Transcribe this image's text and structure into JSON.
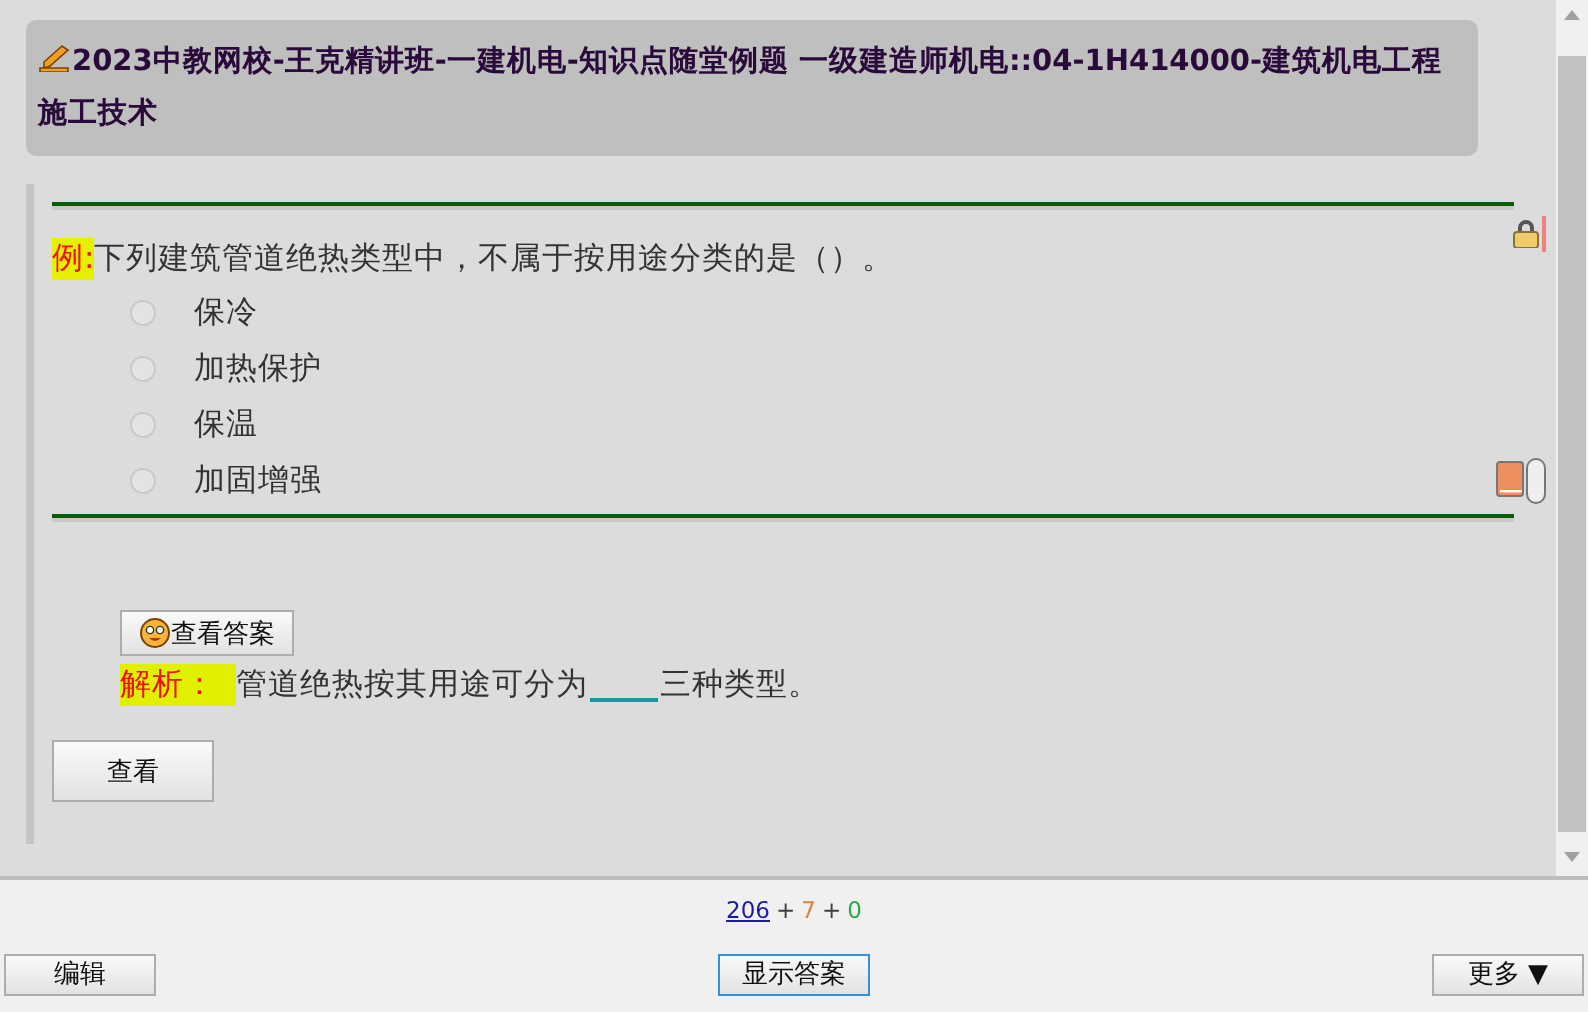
{
  "header": {
    "title": "2023中教网校-王克精讲班-一建机电-知识点随堂例题 一级建造师机电::04-1H414000-建筑机电工程施工技术"
  },
  "question": {
    "tag": "例:",
    "text": "下列建筑管道绝热类型中，不属于按用途分类的是（）。",
    "options": [
      {
        "label": "保冷",
        "selected": false
      },
      {
        "label": "加热保护",
        "selected": false
      },
      {
        "label": "保温",
        "selected": false
      },
      {
        "label": "加固增强",
        "selected": false
      }
    ]
  },
  "show_answer_button": "查看答案",
  "analysis": {
    "label": "解析：",
    "before": "管道绝热按其用途可分为",
    "after": "三种类型。"
  },
  "check_button": "查看",
  "counts": [
    {
      "text": "206",
      "color": "#1a1aa6",
      "kind": "link"
    },
    {
      "text": "+",
      "color": "#404040",
      "kind": "plain"
    },
    {
      "text": "7",
      "color": "#d9843a",
      "kind": "plain"
    },
    {
      "text": "+",
      "color": "#404040",
      "kind": "plain"
    },
    {
      "text": "0",
      "color": "#2aa84a",
      "kind": "plain"
    }
  ],
  "bottom_buttons": [
    {
      "label": "编辑",
      "kind": "left"
    },
    {
      "label": "显示答案",
      "kind": "center"
    },
    {
      "label": "更多 ▼",
      "kind": "right"
    }
  ]
}
